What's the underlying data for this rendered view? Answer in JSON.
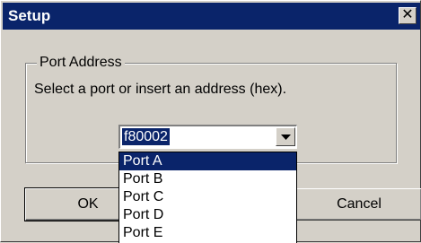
{
  "window": {
    "title": "Setup",
    "close_icon": "close-icon",
    "accent_color": "#0a246a"
  },
  "group": {
    "legend": "Port Address",
    "instruction": "Select a port or insert an address (hex)."
  },
  "combo": {
    "value": "f80002",
    "dropdown_icon": "chevron-down-icon",
    "options": [
      "Port A",
      "Port B",
      "Port C",
      "Port D",
      "Port E"
    ],
    "highlighted": "Port A"
  },
  "buttons": {
    "ok": "OK",
    "cancel": "Cancel"
  }
}
